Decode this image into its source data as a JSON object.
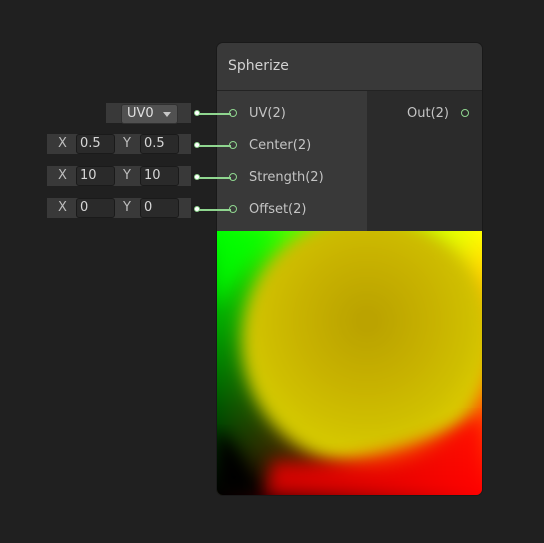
{
  "node": {
    "title": "Spherize",
    "inputs": [
      {
        "label": "UV(2)"
      },
      {
        "label": "Center(2)"
      },
      {
        "label": "Strength(2)"
      },
      {
        "label": "Offset(2)"
      }
    ],
    "outputs": [
      {
        "label": "Out(2)"
      }
    ]
  },
  "uv_dropdown": {
    "value": "UV0"
  },
  "center": {
    "x_label": "X",
    "x": "0.5",
    "y_label": "Y",
    "y": "0.5"
  },
  "strength": {
    "x_label": "X",
    "x": "10",
    "y_label": "Y",
    "y": "10"
  },
  "offset": {
    "x_label": "X",
    "x": "0",
    "y_label": "Y",
    "y": "0"
  },
  "colors": {
    "port": "#8fd68f",
    "header": "#393939",
    "body": "#2b2b2b",
    "background": "#202020"
  },
  "icons": [
    "dropdown-caret-icon",
    "port-icon",
    "wire-connector-icon"
  ]
}
